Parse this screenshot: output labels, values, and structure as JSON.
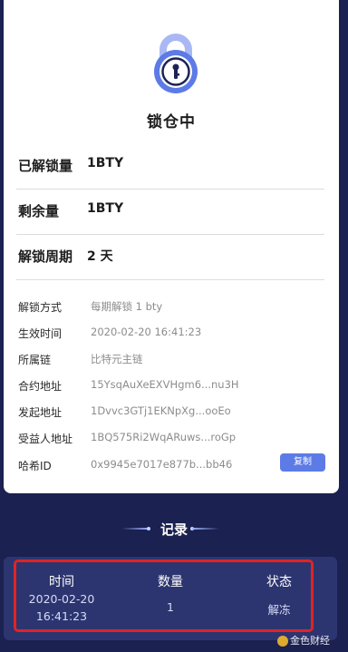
{
  "status": {
    "title": "锁仓中",
    "icon": "lock-icon",
    "accent": "#5d7be6"
  },
  "summary": [
    {
      "label": "已解锁量",
      "value": "1BTY"
    },
    {
      "label": "剩余量",
      "value": "1BTY"
    },
    {
      "label": "解锁周期",
      "value": "2 天"
    }
  ],
  "details": [
    {
      "label": "解锁方式",
      "value": "每期解锁 1 bty"
    },
    {
      "label": "生效时间",
      "value": "2020-02-20 16:41:23"
    },
    {
      "label": "所属链",
      "value": "比特元主链"
    },
    {
      "label": "合约地址",
      "value": "15YsqAuXeEXVHgm6...nu3H"
    },
    {
      "label": "发起地址",
      "value": "1Dvvc3GTj1EKNpXg...ooEo"
    },
    {
      "label": "受益人地址",
      "value": "1BQ575Ri2WqARuws...roGp"
    },
    {
      "label": "哈希ID",
      "value": "0x9945e7017e877b...bb46"
    }
  ],
  "copy_button": {
    "label": "复制"
  },
  "records": {
    "heading": "记录",
    "columns": [
      "时间",
      "数量",
      "状态"
    ],
    "rows": [
      {
        "time_date": "2020-02-20",
        "time_clock": "16:41:23",
        "amount": "1",
        "status": "解冻"
      }
    ],
    "highlight_color": "#e02424"
  },
  "watermark": {
    "text": "金色财经"
  }
}
